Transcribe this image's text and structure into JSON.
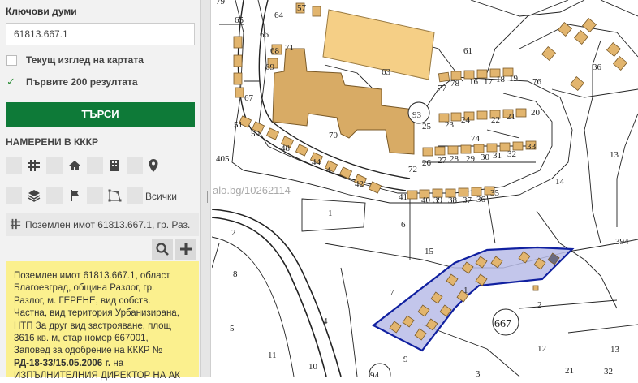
{
  "keywords_label": "Ключови думи",
  "search_value": "61813.667.1",
  "current_view_label": "Текущ изглед на картата",
  "first_200_label": "Първите 200 резултата",
  "search_button": "ТЪРСИ",
  "found_in_label": "НАМЕРЕНИ В КККР",
  "all_label": "Всички",
  "result_title": "Поземлен имот 61813.667.1, гр. Раз.",
  "info": {
    "line1": "Поземлен имот 61813.667.1, област",
    "line2": "Благоевград, община Разлог, гр.",
    "line3": "Разлог, м. ГЕРЕНЕ, вид собств.",
    "line4": "Частна, вид територия Урбанизирана,",
    "line5": "НТП За друг вид застрояване, площ",
    "line6": "3616 кв. м, стар номер 667001,",
    "line7": "Заповед за одобрение на КККР №",
    "line8_bold": "РД-18-33/15.05.2006 г.",
    "line8_rest": " на",
    "line9": "ИЗПЪЛНИТЕЛНИЯ ДИРЕКТОР НА АК"
  },
  "map": {
    "watermark": "alo.bg/10262114",
    "labels": [
      "79",
      "65",
      "64",
      "57",
      "66",
      "71",
      "68",
      "69",
      "63",
      "61",
      "62",
      "93",
      "70",
      "67",
      "77",
      "78",
      "16",
      "17",
      "18",
      "19",
      "76",
      "75",
      "3",
      "36",
      "51",
      "50",
      "49",
      "48",
      "47",
      "46",
      "45",
      "44",
      "43",
      "42",
      "25",
      "23",
      "24",
      "22",
      "21",
      "20",
      "74",
      "26",
      "27",
      "28",
      "29",
      "30",
      "31",
      "32",
      "33",
      "72",
      "73",
      "405",
      "1",
      "41",
      "40",
      "39",
      "38",
      "37",
      "36",
      "35",
      "14",
      "13",
      "2",
      "6",
      "15",
      "394",
      "8",
      "7",
      "4",
      "5",
      "11",
      "10",
      "9",
      "94",
      "3",
      "2",
      "667",
      "12",
      "13",
      "32",
      "21",
      "1"
    ],
    "main_parcel": "667"
  }
}
